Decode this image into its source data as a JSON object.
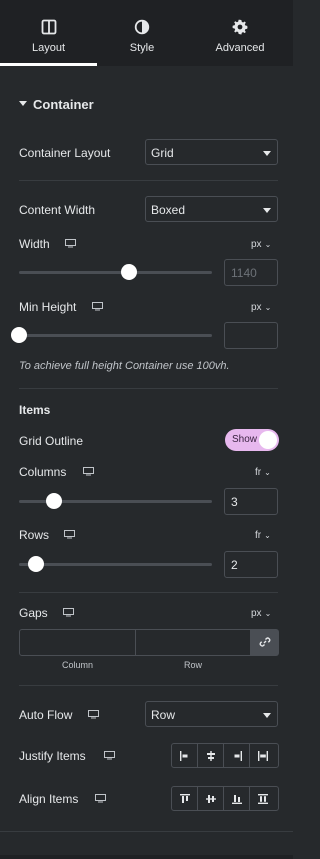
{
  "tabs": [
    {
      "label": "Layout",
      "icon": "layout-icon",
      "active": true
    },
    {
      "label": "Style",
      "icon": "style-icon",
      "active": false
    },
    {
      "label": "Advanced",
      "icon": "gear-icon",
      "active": false
    }
  ],
  "section": {
    "title": "Container"
  },
  "container_layout": {
    "label": "Container Layout",
    "value": "Grid"
  },
  "content_width": {
    "label": "Content Width",
    "value": "Boxed"
  },
  "width": {
    "label": "Width",
    "unit": "px",
    "value": "",
    "placeholder": "1140",
    "slider_fraction": 0.57
  },
  "min_height": {
    "label": "Min Height",
    "unit": "px",
    "value": "",
    "slider_fraction": 0.0
  },
  "note": "To achieve full height Container use 100vh.",
  "items": {
    "title": "Items",
    "grid_outline": {
      "label": "Grid Outline",
      "toggle_label": "Show",
      "on": true
    },
    "columns": {
      "label": "Columns",
      "unit": "fr",
      "value": "3",
      "slider_fraction": 0.18
    },
    "rows": {
      "label": "Rows",
      "unit": "fr",
      "value": "2",
      "slider_fraction": 0.09
    }
  },
  "gaps": {
    "label": "Gaps",
    "unit": "px",
    "column_label": "Column",
    "row_label": "Row"
  },
  "auto_flow": {
    "label": "Auto Flow",
    "value": "Row"
  },
  "justify_items": {
    "label": "Justify Items",
    "options": [
      "justify-start-icon",
      "justify-center-icon",
      "justify-end-icon",
      "justify-stretch-icon"
    ]
  },
  "align_items": {
    "label": "Align Items",
    "options": [
      "align-start-icon",
      "align-center-icon",
      "align-end-icon",
      "align-stretch-icon"
    ]
  },
  "colors": {
    "accent_toggle": "#e7b8ee",
    "panel_bg": "#26292c",
    "tabs_bg": "#1f2124"
  }
}
